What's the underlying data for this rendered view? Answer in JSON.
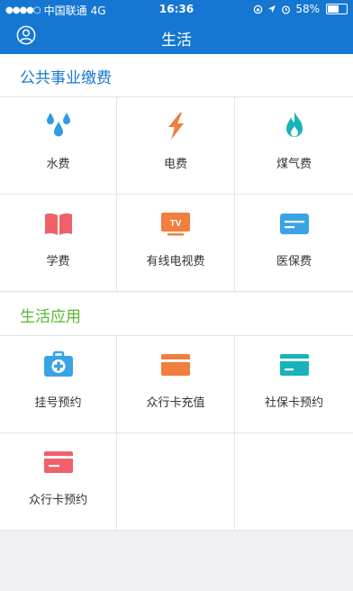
{
  "status_bar": {
    "signal": "●●●●○",
    "carrier": "中国联通",
    "network": "4G",
    "time": "16:36",
    "battery": "58%",
    "battery_level": 0.58
  },
  "nav": {
    "title": "生活",
    "left_icon": "user-circle-icon"
  },
  "sections": [
    {
      "title": "公共事业缴费",
      "title_color": "#1677d2",
      "items": [
        {
          "label": "水费",
          "icon": "water-drops-icon",
          "color": "#2f9be2"
        },
        {
          "label": "电费",
          "icon": "lightning-icon",
          "color": "#f07e3c"
        },
        {
          "label": "煤气费",
          "icon": "flame-icon",
          "color": "#17b3b8"
        },
        {
          "label": "学费",
          "icon": "book-icon",
          "color": "#f0606a"
        },
        {
          "label": "有线电视费",
          "icon": "tv-icon",
          "color": "#f07e3c"
        },
        {
          "label": "医保费",
          "icon": "card-icon",
          "color": "#3aa3e6"
        }
      ]
    },
    {
      "title": "生活应用",
      "title_color": "#58b832",
      "items": [
        {
          "label": "挂号预约",
          "icon": "medical-kit-icon",
          "color": "#3aa3e6"
        },
        {
          "label": "众行卡充值",
          "icon": "card-icon",
          "color": "#f07e3c"
        },
        {
          "label": "社保卡预约",
          "icon": "card-icon",
          "color": "#17b3b8"
        },
        {
          "label": "众行卡预约",
          "icon": "card-icon",
          "color": "#f0606a"
        }
      ]
    }
  ]
}
